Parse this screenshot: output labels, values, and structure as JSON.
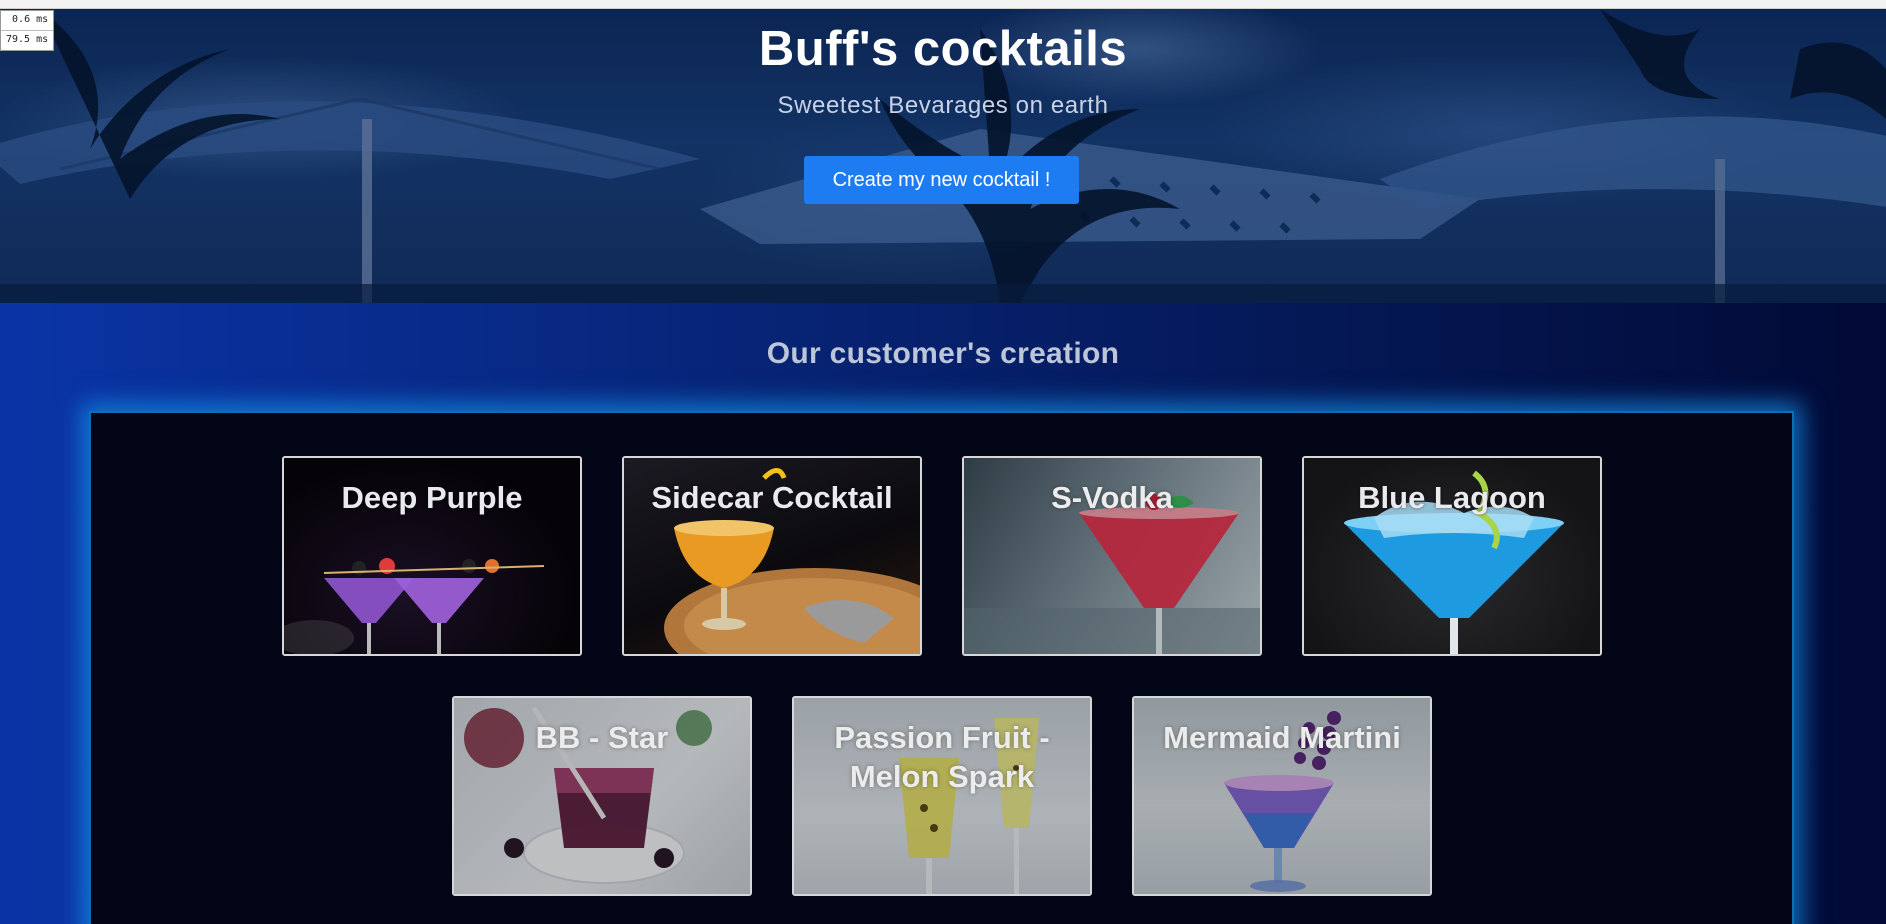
{
  "perf": {
    "line1": "0.6 ms",
    "line2": "79.5 ms"
  },
  "hero": {
    "title": "Buff's cocktails",
    "subtitle": "Sweetest Bevarages on earth",
    "cta_label": "Create my new cocktail !"
  },
  "section": {
    "title": "Our customer's creation"
  },
  "cocktails": [
    {
      "name": "Deep Purple",
      "drink_color": "#9b5fd6",
      "background": "dark"
    },
    {
      "name": "Sidecar Cocktail",
      "drink_color": "#d98a1c",
      "background": "dark"
    },
    {
      "name": "S-Vodka",
      "drink_color": "#e8334f",
      "background": "light"
    },
    {
      "name": "Blue Lagoon",
      "drink_color": "#1e9be0",
      "background": "dark"
    },
    {
      "name": "BB - Star",
      "drink_color": "#6b1c3e",
      "background": "light"
    },
    {
      "name": "Passion Fruit - Melon Spark",
      "drink_color": "#e4de5e",
      "background": "light"
    },
    {
      "name": "Mermaid Martini",
      "drink_color": "#7a5ad0",
      "background": "light"
    }
  ],
  "colors": {
    "accent": "#1e7cf2",
    "gallery_glow": "#148ce6",
    "card_border": "#d7d7d7"
  }
}
